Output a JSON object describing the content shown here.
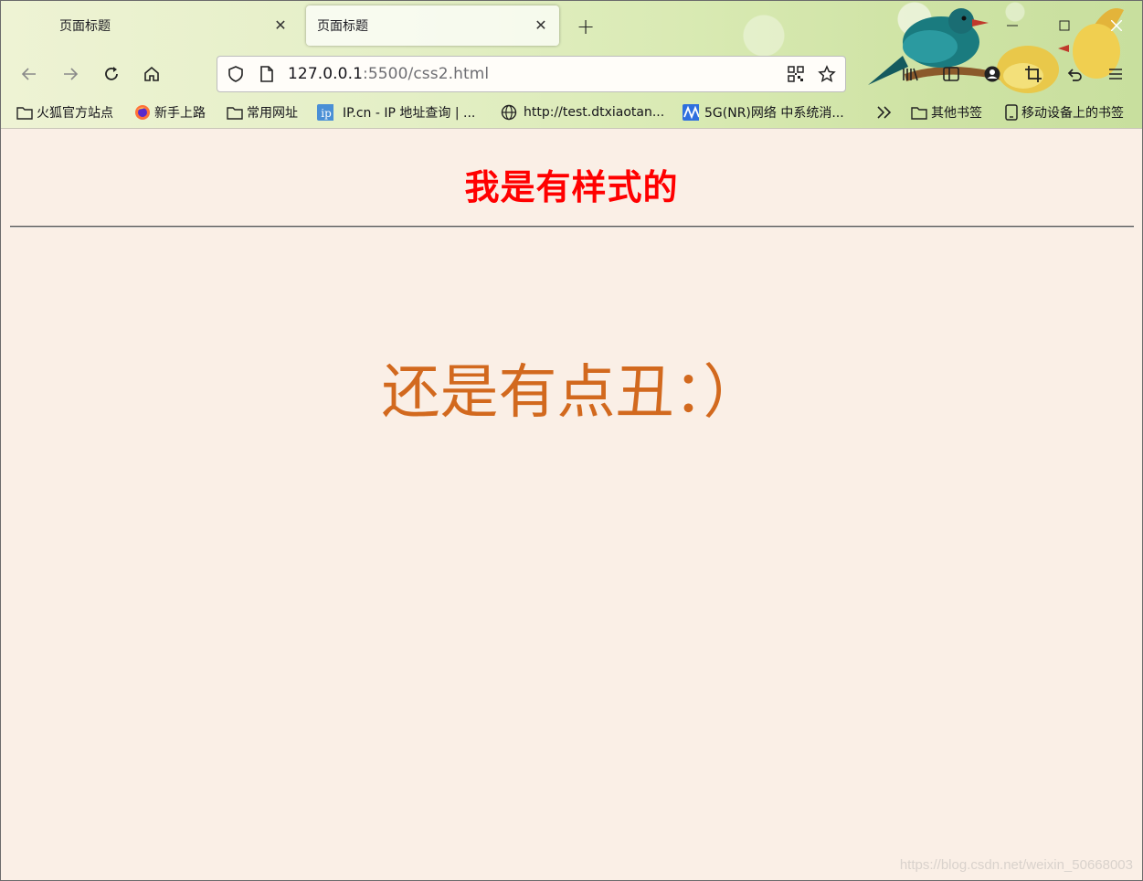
{
  "browser": {
    "tabs": [
      {
        "title": "页面标题",
        "active": false
      },
      {
        "title": "页面标题",
        "active": true
      }
    ],
    "url": {
      "host": "127.0.0.1",
      "rest": ":5500/css2.html"
    },
    "bookmarks": [
      {
        "label": "火狐官方站点",
        "icon": "folder-icon"
      },
      {
        "label": "新手上路",
        "icon": "firefox-icon"
      },
      {
        "label": "常用网址",
        "icon": "folder-icon"
      },
      {
        "label": "IP.cn - IP 地址查询 | ...",
        "icon": "ip-icon"
      },
      {
        "label": "http://test.dtxiaotan...",
        "icon": "globe-icon"
      },
      {
        "label": "5G(NR)网络 中系统消...",
        "icon": "wave-icon"
      },
      {
        "label": "其他书签",
        "icon": "folder-icon"
      },
      {
        "label": "移动设备上的书签",
        "icon": "mobile-icon"
      }
    ],
    "accent_colors": {
      "close_button": "#ffffff",
      "theme": "#d9eab3"
    }
  },
  "page": {
    "heading": "我是有样式的",
    "heading_color": "#ff0000",
    "body_text": "还是有点丑：）",
    "body_color": "#d2691e",
    "background": "#faefe6"
  },
  "watermark": "https://blog.csdn.net/weixin_50668003"
}
